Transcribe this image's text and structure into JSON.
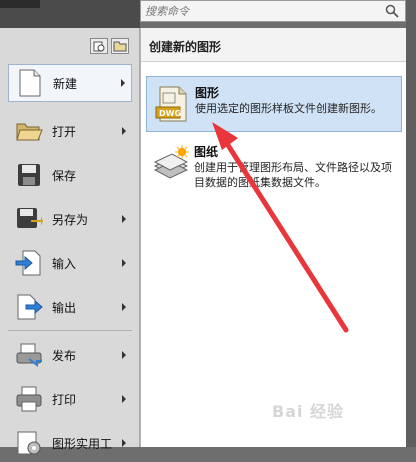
{
  "search": {
    "placeholder": "搜索命令",
    "icon": "search-icon"
  },
  "panel_view_buttons": [
    "recent-documents-icon",
    "open-documents-icon"
  ],
  "menu": [
    {
      "label": "新建",
      "icon": "new-file-icon",
      "submenu": true,
      "active": true
    },
    {
      "label": "打开",
      "icon": "open-folder-icon",
      "submenu": true
    },
    {
      "label": "保存",
      "icon": "save-disk-icon",
      "submenu": false
    },
    {
      "label": "另存为",
      "icon": "save-as-icon",
      "submenu": true
    },
    {
      "label": "输入",
      "icon": "import-icon",
      "submenu": true
    },
    {
      "label": "输出",
      "icon": "export-icon",
      "submenu": true
    },
    {
      "label": "发布",
      "icon": "publish-icon",
      "submenu": true
    },
    {
      "label": "打印",
      "icon": "printer-icon",
      "submenu": true
    },
    {
      "label": "图形实用工",
      "icon": "drawing-utilities-icon",
      "submenu": true
    }
  ],
  "submenu": {
    "header": "创建新的图形",
    "items": [
      {
        "title": "图形",
        "desc": "使用选定的图形样板文件创建新图形。",
        "icon": "dwg-file-icon",
        "highlighted": true
      },
      {
        "title": "图纸",
        "desc": "创建用于管理图形布局、文件路径以及项目数据的图纸集数据文件。",
        "icon": "sheet-set-icon",
        "highlighted": false
      }
    ]
  },
  "watermark": "Bai 经验",
  "colors": {
    "highlight": "#cfe2f6",
    "arrow": "#e8363a",
    "panel": "#d9d9d9"
  }
}
